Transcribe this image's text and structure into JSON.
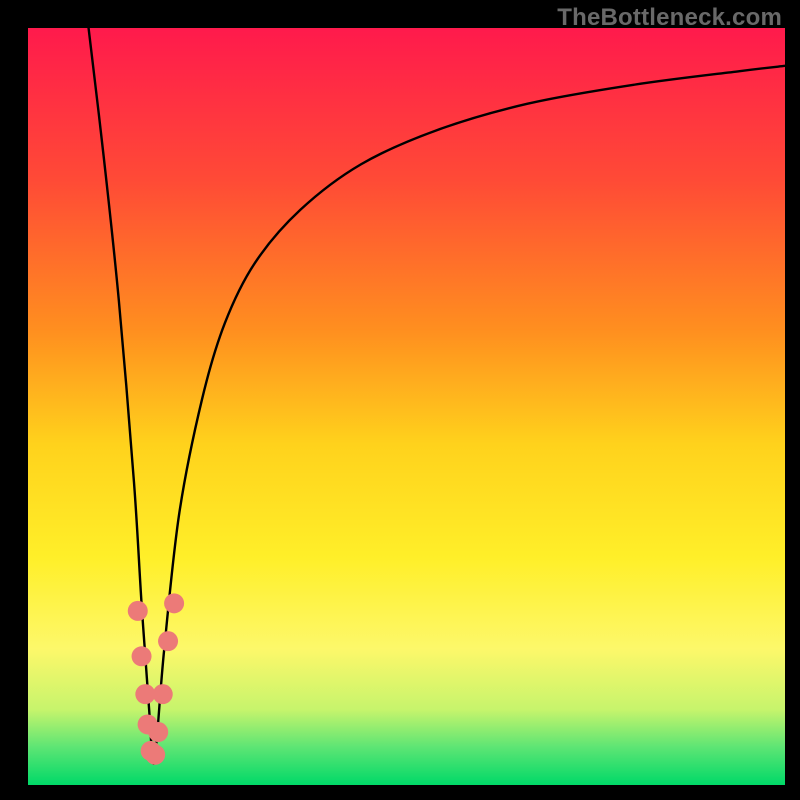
{
  "watermark": "TheBottleneck.com",
  "chart_data": {
    "type": "line",
    "title": "",
    "xlabel": "",
    "ylabel": "",
    "xlim": [
      0,
      100
    ],
    "ylim": [
      0,
      100
    ],
    "gradient_stops": [
      {
        "offset": 0.0,
        "color": "#ff1a4c"
      },
      {
        "offset": 0.2,
        "color": "#ff4a36"
      },
      {
        "offset": 0.4,
        "color": "#ff8f1f"
      },
      {
        "offset": 0.55,
        "color": "#ffd21c"
      },
      {
        "offset": 0.7,
        "color": "#ffef29"
      },
      {
        "offset": 0.82,
        "color": "#fdf86a"
      },
      {
        "offset": 0.9,
        "color": "#c7f46c"
      },
      {
        "offset": 0.95,
        "color": "#5de574"
      },
      {
        "offset": 1.0,
        "color": "#00d968"
      }
    ],
    "series": [
      {
        "name": "bottleneck-curve",
        "x": [
          8,
          10,
          12,
          14,
          15,
          16,
          16.5,
          17,
          18,
          20,
          23,
          26,
          30,
          36,
          44,
          54,
          66,
          80,
          94,
          100
        ],
        "y": [
          100,
          83,
          64,
          40,
          24,
          10,
          3,
          6,
          18,
          36,
          51,
          61,
          69,
          76,
          82,
          86.5,
          90,
          92.5,
          94.3,
          95
        ]
      }
    ],
    "markers": {
      "name": "highlight-points",
      "color": "#ec7a78",
      "radius": 10,
      "points": [
        {
          "x": 14.5,
          "y": 23
        },
        {
          "x": 15.0,
          "y": 17
        },
        {
          "x": 15.5,
          "y": 12
        },
        {
          "x": 15.8,
          "y": 8
        },
        {
          "x": 16.2,
          "y": 4.5
        },
        {
          "x": 16.8,
          "y": 4
        },
        {
          "x": 17.2,
          "y": 7
        },
        {
          "x": 17.8,
          "y": 12
        },
        {
          "x": 18.5,
          "y": 19
        },
        {
          "x": 19.3,
          "y": 24
        }
      ]
    }
  }
}
